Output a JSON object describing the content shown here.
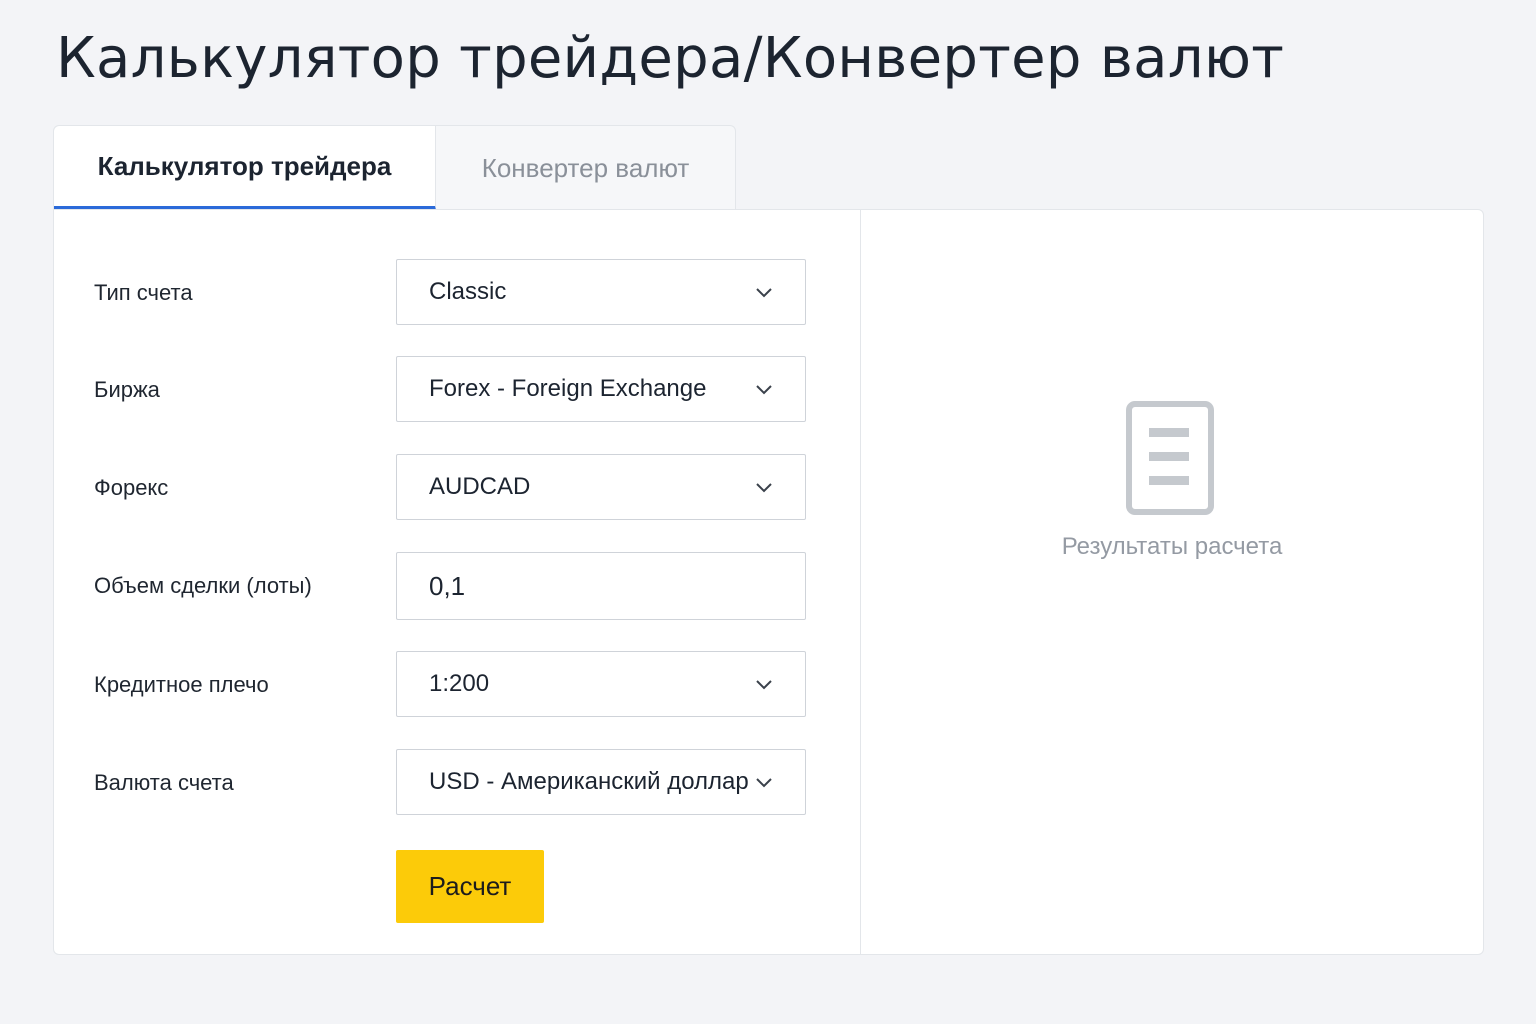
{
  "page": {
    "title": "Калькулятор трейдера/Конвертер валют"
  },
  "tabs": [
    {
      "label": "Калькулятор трейдера",
      "active": true
    },
    {
      "label": "Конвертер валют",
      "active": false
    }
  ],
  "form": {
    "account_type": {
      "label": "Тип счета",
      "value": "Classic"
    },
    "exchange": {
      "label": "Биржа",
      "value": "Forex - Foreign Exchange"
    },
    "instrument": {
      "label": "Форекс",
      "value": "AUDCAD"
    },
    "volume": {
      "label": "Объем сделки (лоты)",
      "value": "0,1"
    },
    "leverage": {
      "label": "Кредитное плечо",
      "value": "1:200"
    },
    "currency": {
      "label": "Валюта счета",
      "value": "USD - Американский доллар"
    },
    "submit_label": "Расчет"
  },
  "results": {
    "placeholder": "Результаты расчета",
    "icon": "document-icon"
  },
  "colors": {
    "accent_tab": "#2b6ad9",
    "button": "#fccb09",
    "background": "#f3f4f7"
  }
}
